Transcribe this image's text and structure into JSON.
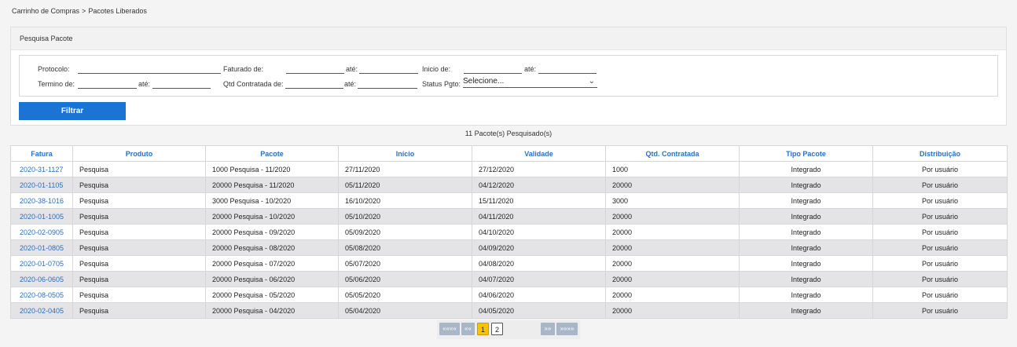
{
  "breadcrumb": {
    "parent": "Carrinho de Compras",
    "separator": ">",
    "current": "Pacotes Liberados"
  },
  "filter": {
    "title": "Pesquisa Pacote",
    "protocolo_label": "Protocolo:",
    "faturado_label": "Faturado de:",
    "ate_label": "até:",
    "inicio_label": "Inicio de:",
    "termino_label": "Termino de:",
    "qtd_label": "Qtd Contratada de:",
    "status_label": "Status Pgto:",
    "status_value": "Selecione...",
    "button_label": "Filtrar"
  },
  "results": {
    "count_text": "11 Pacote(s) Pesquisado(s)",
    "columns": [
      "Fatura",
      "Produto",
      "Pacote",
      "Início",
      "Validade",
      "Qtd. Contratada",
      "Tipo Pacote",
      "Distribuição"
    ],
    "rows": [
      [
        "2020-31-1127",
        "Pesquisa",
        "1000 Pesquisa - 11/2020",
        "27/11/2020",
        "27/12/2020",
        "1000",
        "Integrado",
        "Por usuário"
      ],
      [
        "2020-01-1105",
        "Pesquisa",
        "20000 Pesquisa - 11/2020",
        "05/11/2020",
        "04/12/2020",
        "20000",
        "Integrado",
        "Por usuário"
      ],
      [
        "2020-38-1016",
        "Pesquisa",
        "3000 Pesquisa - 10/2020",
        "16/10/2020",
        "15/11/2020",
        "3000",
        "Integrado",
        "Por usuário"
      ],
      [
        "2020-01-1005",
        "Pesquisa",
        "20000 Pesquisa - 10/2020",
        "05/10/2020",
        "04/11/2020",
        "20000",
        "Integrado",
        "Por usuário"
      ],
      [
        "2020-02-0905",
        "Pesquisa",
        "20000 Pesquisa - 09/2020",
        "05/09/2020",
        "04/10/2020",
        "20000",
        "Integrado",
        "Por usuário"
      ],
      [
        "2020-01-0805",
        "Pesquisa",
        "20000 Pesquisa - 08/2020",
        "05/08/2020",
        "04/09/2020",
        "20000",
        "Integrado",
        "Por usuário"
      ],
      [
        "2020-01-0705",
        "Pesquisa",
        "20000 Pesquisa - 07/2020",
        "05/07/2020",
        "04/08/2020",
        "20000",
        "Integrado",
        "Por usuário"
      ],
      [
        "2020-06-0605",
        "Pesquisa",
        "20000 Pesquisa - 06/2020",
        "05/06/2020",
        "04/07/2020",
        "20000",
        "Integrado",
        "Por usuário"
      ],
      [
        "2020-08-0505",
        "Pesquisa",
        "20000 Pesquisa - 05/2020",
        "05/05/2020",
        "04/06/2020",
        "20000",
        "Integrado",
        "Por usuário"
      ],
      [
        "2020-02-0405",
        "Pesquisa",
        "20000 Pesquisa - 04/2020",
        "05/04/2020",
        "04/05/2020",
        "20000",
        "Integrado",
        "Por usuário"
      ]
    ]
  },
  "pagination": {
    "first": "««««",
    "prev": "««",
    "pages": [
      "1",
      "2"
    ],
    "current": "1",
    "next": "»»",
    "last": "»»»»"
  },
  "colors": {
    "accent": "#1b73d3",
    "link": "#2a6fc2",
    "active_page": "#f7c400"
  }
}
